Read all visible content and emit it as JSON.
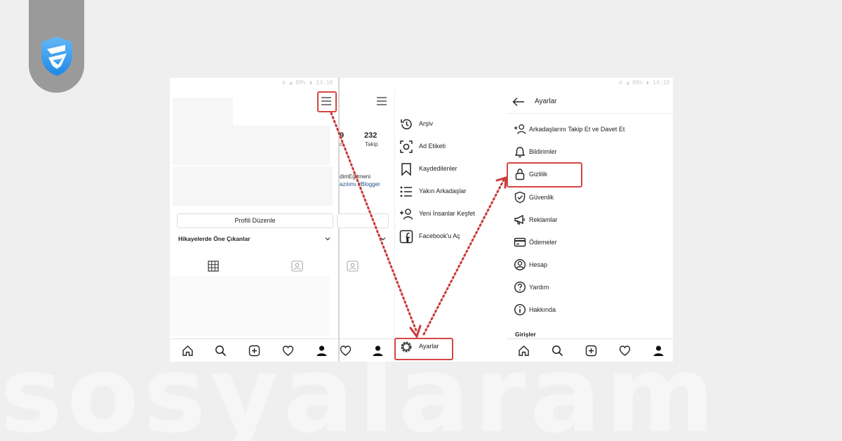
{
  "watermark": "sosyalaram",
  "colors": {
    "accent_red": "#d64545",
    "arrow_red": "#c93b3b",
    "logo_blue": "#2196f3"
  },
  "status_text": "⚙ ◢ 88% ▮ 14:18",
  "profile": {
    "edit_button": "Profili Düzenle",
    "highlights": "Hikayelerde Öne Çıkanlar",
    "stats_partial": "9",
    "following_count": "232",
    "following_label": "Takip",
    "stats_partial_label": "ci",
    "bio_line1": "dimEğitmeni",
    "bio_line2": "azılımı #Blogger"
  },
  "menu": {
    "items": [
      {
        "label": "Arşiv",
        "icon": "history-icon"
      },
      {
        "label": "Ad Etiketi",
        "icon": "nametag-icon"
      },
      {
        "label": "Kaydedilenler",
        "icon": "bookmark-icon"
      },
      {
        "label": "Yakın Arkadaşlar",
        "icon": "list-icon"
      },
      {
        "label": "Yeni İnsanlar Keşfet",
        "icon": "add-person-icon"
      },
      {
        "label": "Facebook'u Aç",
        "icon": "facebook-icon"
      }
    ],
    "settings_label": "Ayarlar"
  },
  "settings": {
    "title": "Ayarlar",
    "items": [
      {
        "label": "Arkadaşlarını Takip Et ve Davet Et",
        "icon": "add-person-icon"
      },
      {
        "label": "Bildirimler",
        "icon": "bell-icon"
      },
      {
        "label": "Gizlilik",
        "icon": "lock-icon"
      },
      {
        "label": "Güvenlik",
        "icon": "shield-check-icon"
      },
      {
        "label": "Reklamlar",
        "icon": "megaphone-icon"
      },
      {
        "label": "Ödemeler",
        "icon": "card-icon"
      },
      {
        "label": "Hesap",
        "icon": "account-icon"
      },
      {
        "label": "Yardım",
        "icon": "help-icon"
      },
      {
        "label": "Hakkında",
        "icon": "info-icon"
      }
    ],
    "section_logins": "Girişler"
  }
}
